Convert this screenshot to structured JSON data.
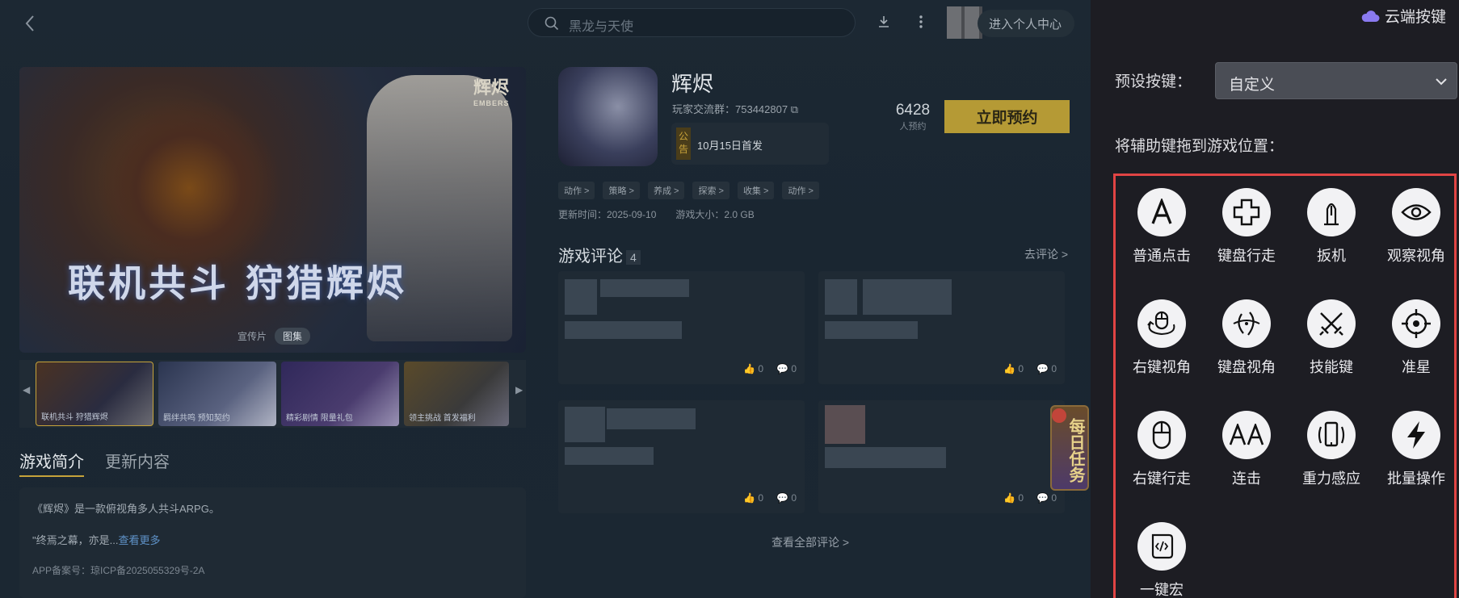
{
  "topbar": {
    "search_placeholder": "黑龙与天使",
    "user_center": "进入个人中心"
  },
  "media": {
    "brand": "辉烬",
    "brand_sub": "EMBERS",
    "banner": "联机共斗 狩猎辉烬",
    "tab_video": "宣传片",
    "tab_gallery": "图集",
    "thumbs": [
      {
        "caption": "联机共斗 狩猎辉烬"
      },
      {
        "caption": "羁绊共鸣 预知契约"
      },
      {
        "caption": "精彩剧情 限量礼包"
      },
      {
        "caption": "领主挑战 首发福利"
      }
    ]
  },
  "desc": {
    "tab_intro": "游戏简介",
    "tab_update": "更新内容",
    "line1": "《辉烬》是一款俯视角多人共斗ARPG。",
    "line2": "\"终焉之幕，亦是...",
    "more": "查看更多",
    "icp": "APP备案号：琼ICP备2025055329号-2A"
  },
  "game": {
    "title": "辉烬",
    "group": "玩家交流群：753442807",
    "notice_tag": "公告",
    "notice_text": "10月15日首发",
    "reserve_count": "6428",
    "reserve_label": "人预约",
    "reserve_button": "立即预约",
    "tags": [
      "动作 >",
      "策略 >",
      "养成 >",
      "探索 >",
      "收集 >",
      "动作 >"
    ],
    "update_time": "更新时间：2025-09-10",
    "size": "游戏大小：2.0 GB"
  },
  "reviews": {
    "title": "游戏评论",
    "count": "4",
    "go_review": "去评论 >",
    "all_reviews": "查看全部评论 >",
    "cards": [
      {
        "likes": "0",
        "comments": "0"
      },
      {
        "likes": "0",
        "comments": "0"
      },
      {
        "likes": "0",
        "comments": "0"
      },
      {
        "likes": "0",
        "comments": "0"
      }
    ]
  },
  "daily_task": "每日任务",
  "panel": {
    "cloud_keys": "云端按键",
    "preset_label": "预设按键：",
    "preset_value": "自定义",
    "drag_hint": "将辅助键拖到游戏位置：",
    "keys": [
      {
        "label": "普通点击",
        "icon": "letter-a-icon"
      },
      {
        "label": "键盘行走",
        "icon": "dpad-cross-icon"
      },
      {
        "label": "扳机",
        "icon": "bullet-icon"
      },
      {
        "label": "观察视角",
        "icon": "eye-icon"
      },
      {
        "label": "右键视角",
        "icon": "mouse-rotate-icon"
      },
      {
        "label": "键盘视角",
        "icon": "keyboard-rotate-icon"
      },
      {
        "label": "技能键",
        "icon": "crossed-swords-icon"
      },
      {
        "label": "准星",
        "icon": "crosshair-icon"
      },
      {
        "label": "右键行走",
        "icon": "mouse-icon"
      },
      {
        "label": "连击",
        "icon": "double-a-icon"
      },
      {
        "label": "重力感应",
        "icon": "phone-tilt-icon"
      },
      {
        "label": "批量操作",
        "icon": "lightning-icon"
      },
      {
        "label": "一键宏",
        "icon": "script-icon"
      }
    ]
  }
}
